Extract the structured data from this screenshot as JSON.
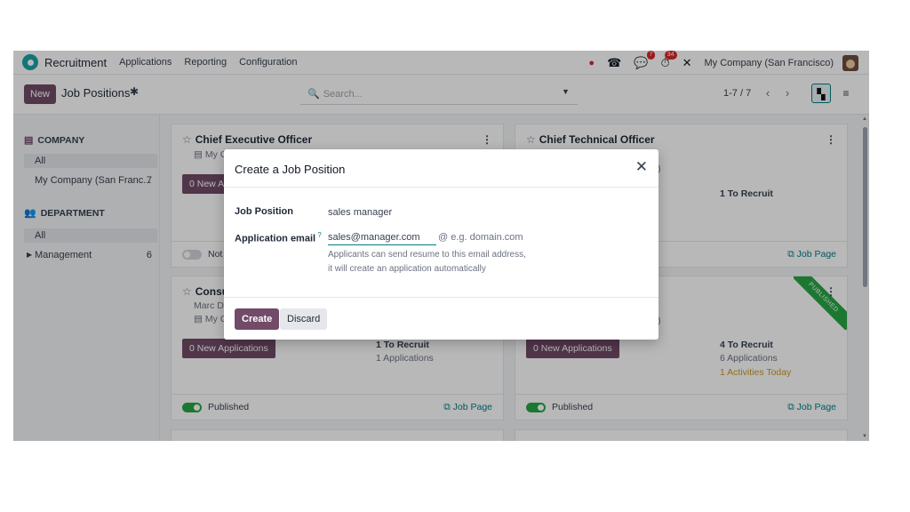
{
  "topnav": {
    "app_name": "Recruitment",
    "menu": [
      "Applications",
      "Reporting",
      "Configuration"
    ],
    "chat_badge": "7",
    "activity_badge": "34",
    "company": "My Company (San Francisco)"
  },
  "control_panel": {
    "new_label": "New",
    "title": "Job Positions",
    "search_placeholder": "Search...",
    "pager": "1-7 / 7"
  },
  "sidebar": {
    "company_heading": "COMPANY",
    "company_items": [
      {
        "label": "All",
        "count": ""
      },
      {
        "label": "My Company (San Franc...",
        "count": "7"
      }
    ],
    "department_heading": "DEPARTMENT",
    "department_items": [
      {
        "label": "All",
        "count": ""
      },
      {
        "label": "Management",
        "count": "6"
      }
    ]
  },
  "cards": {
    "ceo": {
      "title": "Chief Executive Officer",
      "company_line": "My C",
      "apps_button": "0 New A",
      "toggle_label": "Not"
    },
    "cto": {
      "title": "Chief Technical Officer",
      "paren": ")",
      "recruit": "1 To Recruit",
      "job_page": "Job Page"
    },
    "consultant": {
      "title": "Consu",
      "sub1": "Marc D",
      "sub2": "My C",
      "apps_button": "0 New Applications",
      "recruit": "1 To Recruit",
      "applications": "1 Applications",
      "toggle_label": "Published",
      "job_page": "Job Page"
    },
    "fourth": {
      "paren": ")",
      "ribbon": "PUBLISHED",
      "apps_button": "0 New Applications",
      "recruit": "4 To Recruit",
      "applications": "6 Applications",
      "activities": "1 Activities Today",
      "toggle_label": "Published",
      "job_page": "Job Page"
    }
  },
  "modal": {
    "title": "Create a Job Position",
    "job_position_label": "Job Position",
    "job_position_value": "sales manager",
    "email_label": "Application email",
    "email_value": "sales@manager.com",
    "email_hint": "@ e.g. domain.com",
    "help_line1": "Applicants can send resume to this email address,",
    "help_line2": "it will create an application automatically",
    "create_label": "Create",
    "discard_label": "Discard"
  }
}
